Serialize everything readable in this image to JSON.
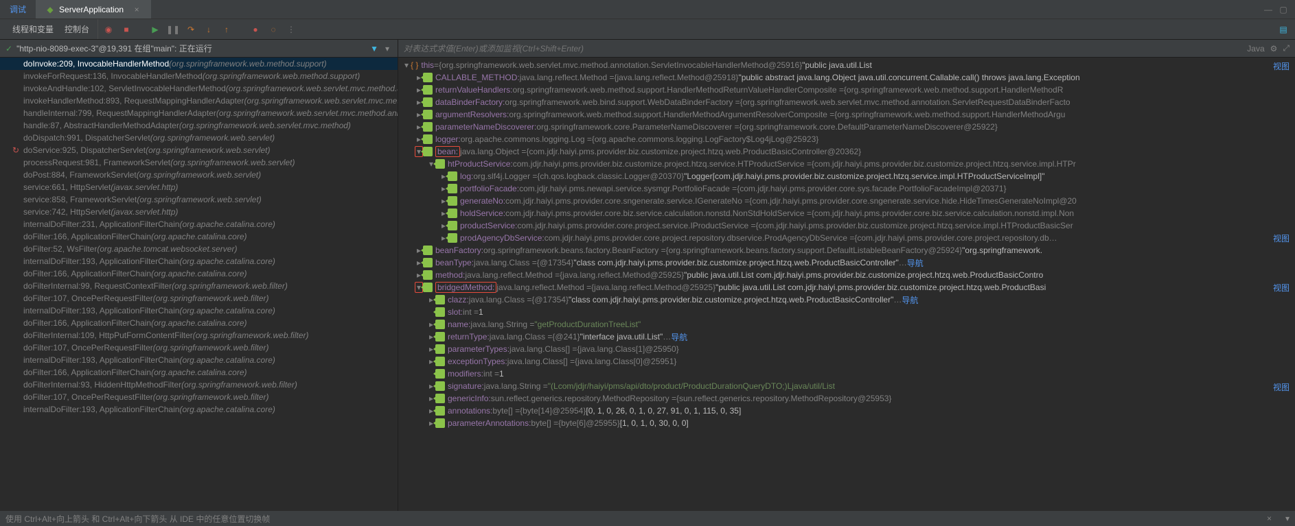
{
  "tabs": {
    "debug": "调试",
    "file": "ServerApplication"
  },
  "toolbar": {
    "varsTab": "线程和变量",
    "consoleTab": "控制台"
  },
  "winMin": "—",
  "leftHeader": {
    "text": "\"http-nio-8089-exec-3\"@19,391 在组\"main\": 正在运行"
  },
  "exprPlaceholder": "对表达式求值(Enter)或添加监视(Ctrl+Shift+Enter)",
  "langLabel": "Java",
  "frames": [
    {
      "m": "doInvoke:209, InvocableHandlerMethod ",
      "d": "(org.springframework.web.method.support)",
      "sel": true
    },
    {
      "m": "invokeForRequest:136, InvocableHandlerMethod ",
      "d": "(org.springframework.web.method.support)",
      "dim": true
    },
    {
      "m": "invokeAndHandle:102, ServletInvocableHandlerMethod ",
      "d": "(org.springframework.web.servlet.mvc.method.an",
      "dim": true
    },
    {
      "m": "invokeHandlerMethod:893, RequestMappingHandlerAdapter ",
      "d": "(org.springframework.web.servlet.mvc.meth",
      "dim": true
    },
    {
      "m": "handleInternal:799, RequestMappingHandlerAdapter ",
      "d": "(org.springframework.web.servlet.mvc.method.anno",
      "dim": true
    },
    {
      "m": "handle:87, AbstractHandlerMethodAdapter ",
      "d": "(org.springframework.web.servlet.mvc.method)",
      "dim": true
    },
    {
      "m": "doDispatch:991, DispatcherServlet ",
      "d": "(org.springframework.web.servlet)",
      "dim": true
    },
    {
      "m": "doService:925, DispatcherServlet ",
      "d": "(org.springframework.web.servlet)",
      "dim": true,
      "reload": true
    },
    {
      "m": "processRequest:981, FrameworkServlet ",
      "d": "(org.springframework.web.servlet)",
      "dim": true
    },
    {
      "m": "doPost:884, FrameworkServlet ",
      "d": "(org.springframework.web.servlet)",
      "dim": true
    },
    {
      "m": "service:661, HttpServlet ",
      "d": "(javax.servlet.http)",
      "dim": true
    },
    {
      "m": "service:858, FrameworkServlet ",
      "d": "(org.springframework.web.servlet)",
      "dim": true
    },
    {
      "m": "service:742, HttpServlet ",
      "d": "(javax.servlet.http)",
      "dim": true
    },
    {
      "m": "internalDoFilter:231, ApplicationFilterChain ",
      "d": "(org.apache.catalina.core)",
      "dim": true
    },
    {
      "m": "doFilter:166, ApplicationFilterChain ",
      "d": "(org.apache.catalina.core)",
      "dim": true
    },
    {
      "m": "doFilter:52, WsFilter ",
      "d": "(org.apache.tomcat.websocket.server)",
      "dim": true
    },
    {
      "m": "internalDoFilter:193, ApplicationFilterChain ",
      "d": "(org.apache.catalina.core)",
      "dim": true
    },
    {
      "m": "doFilter:166, ApplicationFilterChain ",
      "d": "(org.apache.catalina.core)",
      "dim": true
    },
    {
      "m": "doFilterInternal:99, RequestContextFilter ",
      "d": "(org.springframework.web.filter)",
      "dim": true
    },
    {
      "m": "doFilter:107, OncePerRequestFilter ",
      "d": "(org.springframework.web.filter)",
      "dim": true
    },
    {
      "m": "internalDoFilter:193, ApplicationFilterChain ",
      "d": "(org.apache.catalina.core)",
      "dim": true
    },
    {
      "m": "doFilter:166, ApplicationFilterChain ",
      "d": "(org.apache.catalina.core)",
      "dim": true
    },
    {
      "m": "doFilterInternal:109, HttpPutFormContentFilter ",
      "d": "(org.springframework.web.filter)",
      "dim": true
    },
    {
      "m": "doFilter:107, OncePerRequestFilter ",
      "d": "(org.springframework.web.filter)",
      "dim": true
    },
    {
      "m": "internalDoFilter:193, ApplicationFilterChain ",
      "d": "(org.apache.catalina.core)",
      "dim": true
    },
    {
      "m": "doFilter:166, ApplicationFilterChain ",
      "d": "(org.apache.catalina.core)",
      "dim": true
    },
    {
      "m": "doFilterInternal:93, HiddenHttpMethodFilter ",
      "d": "(org.springframework.web.filter)",
      "dim": true
    },
    {
      "m": "doFilter:107, OncePerRequestFilter ",
      "d": "(org.springframework.web.filter)",
      "dim": true
    },
    {
      "m": "internalDoFilter:193, ApplicationFilterChain ",
      "d": "(org.apache.catalina.core)",
      "dim": true
    }
  ],
  "vars": [
    {
      "ind": 0,
      "arrow": "▾",
      "k": "this",
      "sep": " = ",
      "v": "{org.springframework.web.servlet.mvc.method.annotation.ServletInvocableHandlerMethod@25916} ",
      "tail": "\"public java.util.List<com.jdjr.haiyi.pms.provider.biz.customize.proj",
      "braces": true,
      "link": "视图",
      "bracky": true
    },
    {
      "ind": 1,
      "arrow": "▸",
      "k": "CALLABLE_METHOD",
      "g": ": java.lang.reflect.Method  = ",
      "v": "{java.lang.reflect.Method@25918} ",
      "tail": "\"public abstract java.lang.Object java.util.concurrent.Callable.call() throws java.lang.Exception"
    },
    {
      "ind": 1,
      "arrow": "▸",
      "k": "returnValueHandlers",
      "g": ": org.springframework.web.method.support.HandlerMethodReturnValueHandlerComposite  = ",
      "v": "{org.springframework.web.method.support.HandlerMethodR"
    },
    {
      "ind": 1,
      "arrow": "▸",
      "k": "dataBinderFactory",
      "g": ": org.springframework.web.bind.support.WebDataBinderFactory  = ",
      "v": "{org.springframework.web.servlet.mvc.method.annotation.ServletRequestDataBinderFacto"
    },
    {
      "ind": 1,
      "arrow": "▸",
      "k": "argumentResolvers",
      "g": ": org.springframework.web.method.support.HandlerMethodArgumentResolverComposite  = ",
      "v": "{org.springframework.web.method.support.HandlerMethodArgu"
    },
    {
      "ind": 1,
      "arrow": "▸",
      "k": "parameterNameDiscoverer",
      "g": ": org.springframework.core.ParameterNameDiscoverer  = ",
      "v": "{org.springframework.core.DefaultParameterNameDiscoverer@25922}"
    },
    {
      "ind": 1,
      "arrow": "▸",
      "k": "logger",
      "g": ": org.apache.commons.logging.Log  = ",
      "v": "{org.apache.commons.logging.LogFactory$Log4jLog@25923}"
    },
    {
      "ind": 1,
      "arrow": "▾",
      "k": "bean",
      "g": ": java.lang.Object  = ",
      "v": "{com.jdjr.haiyi.pms.provider.biz.customize.project.htzq.web.ProductBasicController@20362}",
      "redbox": true,
      "preArrowRed": true
    },
    {
      "ind": 2,
      "arrow": "▾",
      "k": "htProductService",
      "g": ": com.jdjr.haiyi.pms.provider.biz.customize.project.htzq.service.HTProductService  = ",
      "v": "{com.jdjr.haiyi.pms.provider.biz.customize.project.htzq.service.impl.HTPr"
    },
    {
      "ind": 3,
      "arrow": "▸",
      "k": "log",
      "g": ": org.slf4j.Logger  = ",
      "v": "{ch.qos.logback.classic.Logger@20370} ",
      "tail": "\"Logger[com.jdjr.haiyi.pms.provider.biz.customize.project.htzq.service.impl.HTProductServiceImpl]\""
    },
    {
      "ind": 3,
      "arrow": "▸",
      "k": "portfolioFacade",
      "g": ": com.jdjr.haiyi.pms.newapi.service.sysmgr.PortfolioFacade  = ",
      "v": "{com.jdjr.haiyi.pms.provider.core.sys.facade.PortfolioFacadeImpl@20371}"
    },
    {
      "ind": 3,
      "arrow": "▸",
      "k": "generateNo",
      "g": ": com.jdjr.haiyi.pms.provider.core.sngenerate.service.IGenerateNo  = ",
      "v": "{com.jdjr.haiyi.pms.provider.core.sngenerate.service.hide.HideTimesGenerateNoImpl@20"
    },
    {
      "ind": 3,
      "arrow": "▸",
      "k": "holdService",
      "g": ": com.jdjr.haiyi.pms.provider.core.biz.service.calculation.nonstd.NonStdHoldService  = ",
      "v": "{com.jdjr.haiyi.pms.provider.core.biz.service.calculation.nonstd.impl.Non"
    },
    {
      "ind": 3,
      "arrow": "▸",
      "k": "productService",
      "g": ": com.jdjr.haiyi.pms.provider.core.project.service.IProductService  = ",
      "v": "{com.jdjr.haiyi.pms.provider.biz.customize.project.htzq.service.impl.HTProductBasicSer"
    },
    {
      "ind": 3,
      "arrow": "▸",
      "k": "prodAgencyDbService",
      "g": ": com.jdjr.haiyi.pms.provider.core.project.repository.dbservice.ProdAgencyDbService  = ",
      "v": "{com.jdjr.haiyi.pms.provider.core.project.repository.db",
      "dots": "…",
      "link": "视图"
    },
    {
      "ind": 1,
      "arrow": "▸",
      "k": "beanFactory",
      "g": ": org.springframework.beans.factory.BeanFactory  = ",
      "v": "{org.springframework.beans.factory.support.DefaultListableBeanFactory@25924} ",
      "tail": "\"org.springframework."
    },
    {
      "ind": 1,
      "arrow": "▸",
      "k": "beanType",
      "g": ": java.lang.Class  = ",
      "v": "{@17354} ",
      "tail": "\"class com.jdjr.haiyi.pms.provider.biz.customize.project.htzq.web.ProductBasicController\"",
      "dots": "…",
      "nav": "导航"
    },
    {
      "ind": 1,
      "arrow": "▸",
      "k": "method",
      "g": ": java.lang.reflect.Method  = ",
      "v": "{java.lang.reflect.Method@25925} ",
      "tail": "\"public java.util.List com.jdjr.haiyi.pms.provider.biz.customize.project.htzq.web.ProductBasicContro"
    },
    {
      "ind": 1,
      "arrow": "▾",
      "k": "bridgedMethod",
      "g": ": java.lang.reflect.Method  = ",
      "v": "{java.lang.reflect.Method@25925} ",
      "tail": "\"public java.util.List com.jdjr.haiyi.pms.provider.biz.customize.project.htzq.web.ProductBasi",
      "redbox": true,
      "preArrowRed": true,
      "link": "视图"
    },
    {
      "ind": 2,
      "arrow": "▸",
      "k": "clazz",
      "g": ": java.lang.Class  = ",
      "v": "{@17354} ",
      "tail": "\"class com.jdjr.haiyi.pms.provider.biz.customize.project.htzq.web.ProductBasicController\"",
      "dots": "…",
      "nav": "导航"
    },
    {
      "ind": 2,
      "arrow": "",
      "k": "slot",
      "g": ": int  = ",
      "tail": "1",
      "plain": true
    },
    {
      "ind": 2,
      "arrow": "▸",
      "k": "name",
      "g": ": java.lang.String  = ",
      "tail": "\"getProductDurationTreeList\"",
      "green": true
    },
    {
      "ind": 2,
      "arrow": "▸",
      "k": "returnType",
      "g": ": java.lang.Class  = ",
      "v": "{@241} ",
      "tail": "\"interface java.util.List\"",
      "dots": "…",
      "nav": "导航"
    },
    {
      "ind": 2,
      "arrow": "▸",
      "k": "parameterTypes",
      "g": ": java.lang.Class[]  = ",
      "v": "{java.lang.Class[1]@25950}"
    },
    {
      "ind": 2,
      "arrow": "▸",
      "k": "exceptionTypes",
      "g": ": java.lang.Class[]  = ",
      "v": "{java.lang.Class[0]@25951}"
    },
    {
      "ind": 2,
      "arrow": "",
      "k": "modifiers",
      "g": ": int  = ",
      "tail": "1",
      "plain": true
    },
    {
      "ind": 2,
      "arrow": "▸",
      "k": "signature",
      "g": ": java.lang.String  = ",
      "tail": "\"(Lcom/jdjr/haiyi/pms/api/dto/product/ProductDurationQueryDTO;)Ljava/util/List<Lcom/jdjr/haiyi/pms/provider/biz/customize/project/htzq/",
      "green": true,
      "link": "视图"
    },
    {
      "ind": 2,
      "arrow": "▸",
      "k": "genericInfo",
      "g": ": sun.reflect.generics.repository.MethodRepository  = ",
      "v": "{sun.reflect.generics.repository.MethodRepository@25953}"
    },
    {
      "ind": 2,
      "arrow": "▸",
      "k": "annotations",
      "g": ": byte[]  = ",
      "v": "{byte[14]@25954} ",
      "tail": "[0, 1, 0, 26, 0, 1, 0, 27, 91, 0, 1, 115, 0, 35]"
    },
    {
      "ind": 2,
      "arrow": "▸",
      "k": "parameterAnnotations",
      "g": ": byte[]  = ",
      "v": "{byte[6]@25955} ",
      "tail": "[1, 0, 1, 0, 30, 0, 0]"
    }
  ],
  "statusBar": {
    "hint": "使用 Ctrl+Alt+向上箭头 和 Ctrl+Alt+向下箭头 从 IDE 中的任意位置切换帧"
  }
}
